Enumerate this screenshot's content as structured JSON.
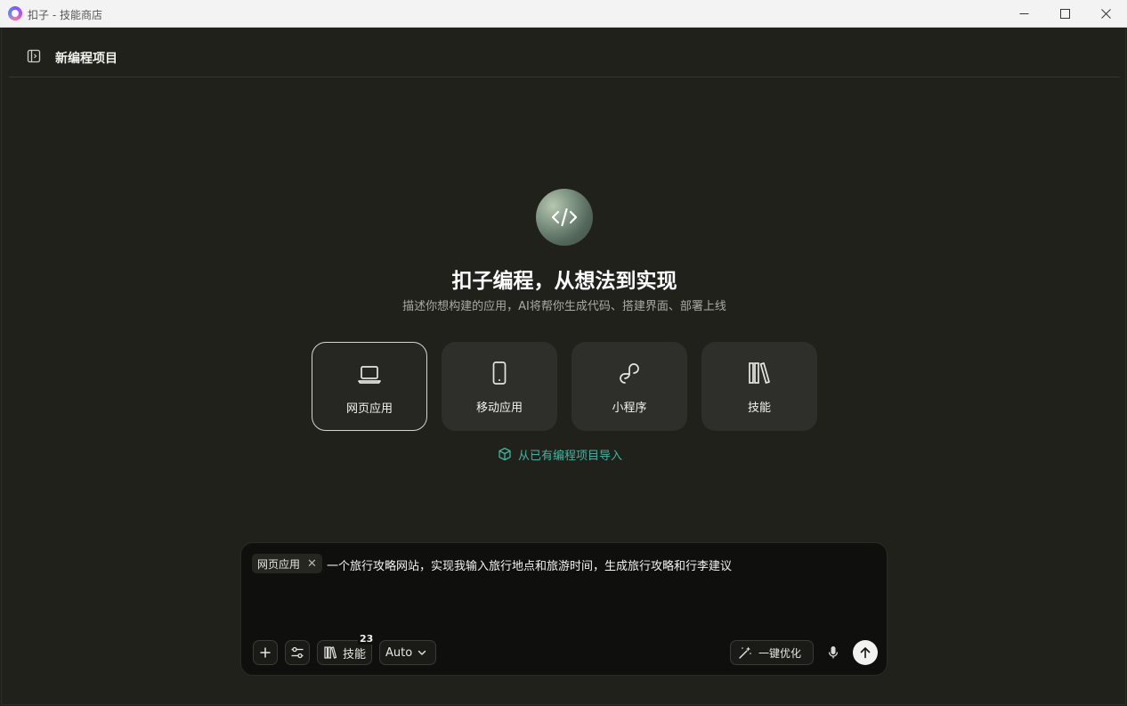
{
  "window": {
    "title": "扣子 - 技能商店",
    "minimize_glyph": "—",
    "maximize_glyph": "☐",
    "close_glyph": "✕"
  },
  "header": {
    "project_title": "新编程项目",
    "sidebar_toggle_icon": "sidebar-toggle-icon"
  },
  "hero": {
    "icon": "code-icon",
    "title": "扣子编程，从想法到实现",
    "subtitle": "描述你想构建的应用，AI将帮你生成代码、搭建界面、部署上线"
  },
  "cards": [
    {
      "label": "网页应用",
      "icon": "laptop-icon",
      "selected": true
    },
    {
      "label": "移动应用",
      "icon": "phone-icon",
      "selected": false
    },
    {
      "label": "小程序",
      "icon": "mini-program-icon",
      "selected": false
    },
    {
      "label": "技能",
      "icon": "books-icon",
      "selected": false
    }
  ],
  "import_link": {
    "label": "从已有编程项目导入",
    "icon": "cube-icon",
    "color": "#3fb4a0"
  },
  "composer": {
    "tag": "网页应用",
    "tag_close": "✕",
    "prompt": "一个旅行攻略网站，实现我输入旅行地点和旅游时间，生成旅行攻略和行李建议",
    "add_glyph": "+",
    "skills_label": "技能",
    "skills_count": "23",
    "model_label": "Auto",
    "optimize_label": "一键优化"
  }
}
